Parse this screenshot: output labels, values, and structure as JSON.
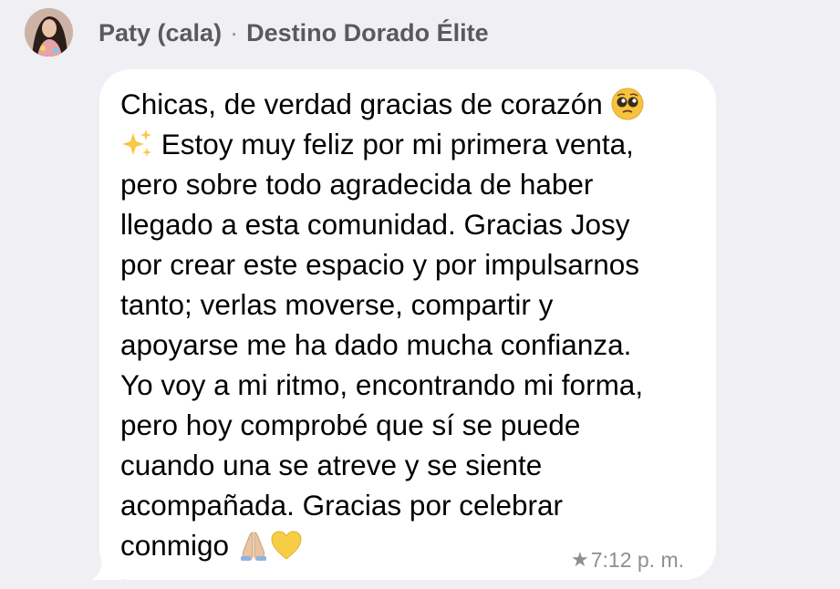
{
  "header": {
    "sender": "Paty (cala)",
    "separator": "·",
    "group": "Destino Dorado Élite"
  },
  "message": {
    "lines": [
      "Chicas, de verdad gracias de corazón",
      "Estoy muy feliz por mi primera venta,",
      "pero sobre todo agradecida de haber",
      "llegado a esta comunidad. Gracias Josy",
      "por crear este espacio y por impulsarnos",
      "tanto; verlas moverse, compartir y",
      "apoyarse me ha dado mucha confianza.",
      "Yo voy a mi ritmo, encontrando mi forma,",
      "pero hoy comprobé que sí se puede",
      "cuando una se atreve y se siente",
      "acompañada. Gracias por celebrar",
      "conmigo"
    ],
    "emojis": [
      "pleading-face-icon",
      "sparkles-icon",
      "folded-hands-icon",
      "yellow-heart-icon"
    ]
  },
  "status": {
    "starred": true,
    "star_glyph": "★",
    "time": "7:12 p. m."
  },
  "colors": {
    "background": "#efeff4",
    "bubble": "#ffffff",
    "secondary_text": "#8e8e93"
  }
}
